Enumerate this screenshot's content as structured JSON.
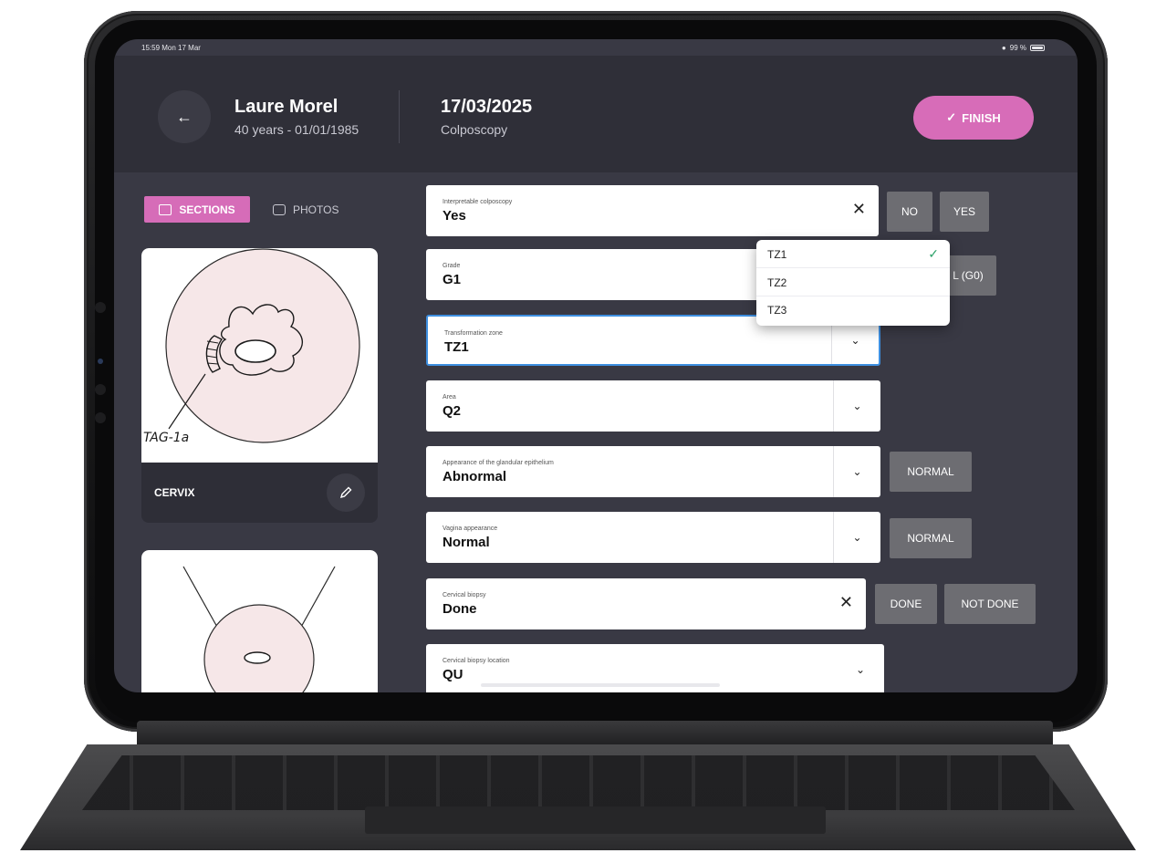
{
  "status": {
    "time": "15:59  Mon 17 Mar",
    "battery": "99 %"
  },
  "header": {
    "patient_name": "Laure Morel",
    "patient_info": "40 years - 01/01/1985",
    "exam_date": "17/03/2025",
    "exam_type": "Colposcopy",
    "finish_label": "FINISH"
  },
  "tabs": {
    "sections": "SECTIONS",
    "photos": "PHOTOS"
  },
  "cards": [
    {
      "label": "CERVIX",
      "annotation": "TAG-1a"
    },
    {
      "label": ""
    }
  ],
  "fields": [
    {
      "label": "Interpretable colposcopy",
      "value": "Yes"
    },
    {
      "label": "Grade",
      "value": "G1"
    },
    {
      "label": "Transformation zone",
      "value": "TZ1"
    },
    {
      "label": "Area",
      "value": "Q2"
    },
    {
      "label": "Appearance of the glandular epithelium",
      "value": "Abnormal"
    },
    {
      "label": "Vagina appearance",
      "value": "Normal"
    },
    {
      "label": "Cervical biopsy",
      "value": "Done"
    },
    {
      "label": "Cervical biopsy location",
      "value": "QU"
    }
  ],
  "chips": {
    "no": "NO",
    "yes": "YES",
    "normal_g0": "L (G0)",
    "normal_glandular": "NORMAL",
    "normal_vagina": "NORMAL",
    "done": "DONE",
    "not_done": "NOT DONE"
  },
  "dropdown": {
    "options": [
      "TZ1",
      "TZ2",
      "TZ3"
    ],
    "selected": "TZ1"
  },
  "colors": {
    "accent": "#d76cb8",
    "focus": "#3e8fe0",
    "check": "#2fa36b"
  }
}
